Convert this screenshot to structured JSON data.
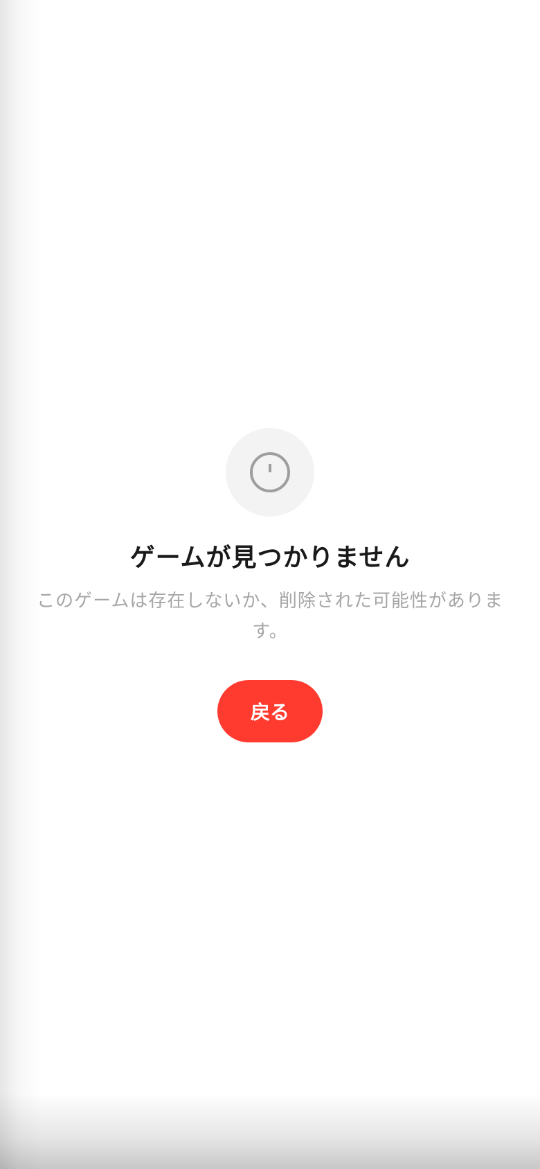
{
  "empty_state": {
    "icon": "alert-circle-icon",
    "title": "ゲームが見つかりません",
    "message": "このゲームは存在しないか、削除された可能性があります。",
    "back_button_label": "戻る"
  },
  "colors": {
    "accent": "#ff3b30",
    "title_text": "#1a1a1a",
    "message_text": "#a6a6a6",
    "icon_bg": "#f3f3f3",
    "icon_stroke": "#9e9e9e"
  }
}
